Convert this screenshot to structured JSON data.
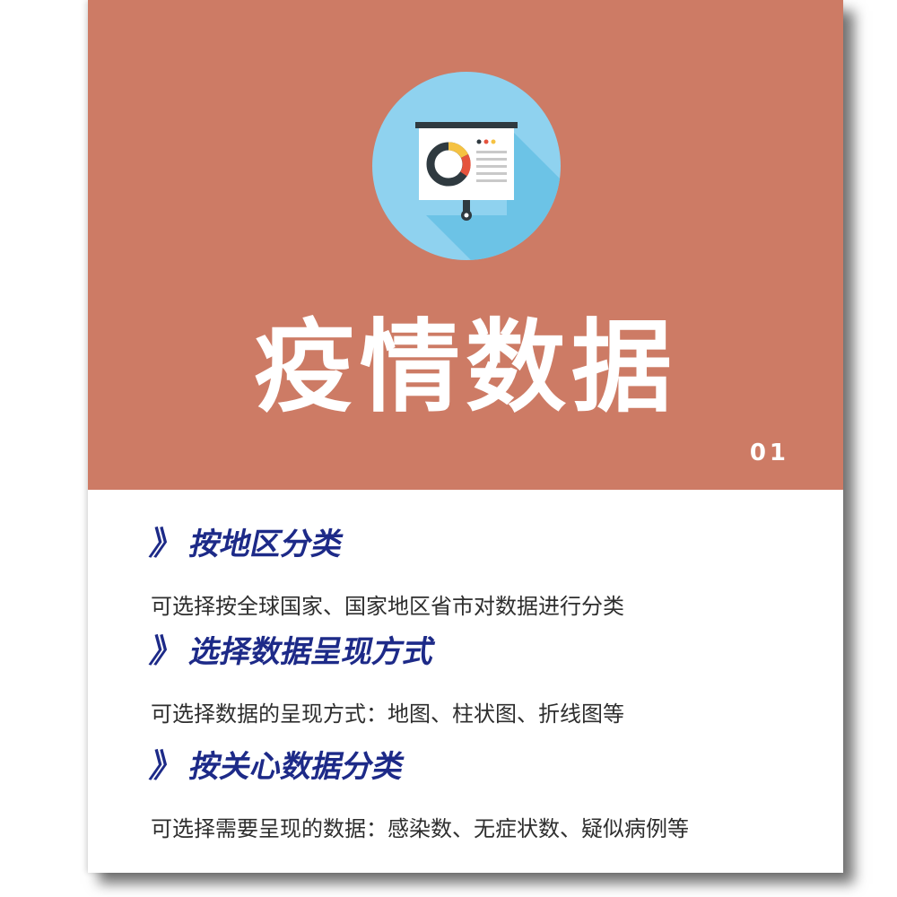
{
  "hero": {
    "title": "疫情数据",
    "number": "01",
    "bg_color": "#cd7b65",
    "icon": "presentation-chart-icon"
  },
  "sections": [
    {
      "icon": "chevron-right-icon",
      "marker": "》",
      "heading": "按地区分类",
      "description": "可选择按全球国家、国家地区省市对数据进行分类"
    },
    {
      "icon": "chevron-right-icon",
      "marker": "》",
      "heading": "选择数据呈现方式",
      "description": "可选择数据的呈现方式：地图、柱状图、折线图等"
    },
    {
      "icon": "chevron-right-icon",
      "marker": "》",
      "heading": "按关心数据分类",
      "description": "可选择需要呈现的数据：感染数、无症状数、疑似病例等"
    }
  ],
  "colors": {
    "heading": "#1d2a88",
    "description": "#2e2e2e",
    "circle": "#8fd2ef"
  }
}
